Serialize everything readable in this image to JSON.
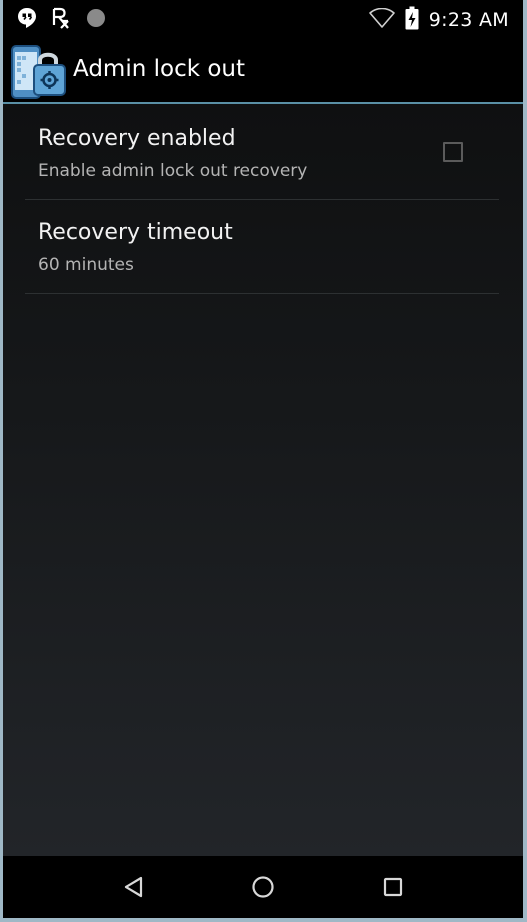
{
  "status_bar": {
    "time": "9:23 AM",
    "icons": [
      "hangouts-icon",
      "rx-icon",
      "circle-icon",
      "wifi-icon",
      "battery-charging-icon"
    ]
  },
  "action_bar": {
    "title": "Admin lock out",
    "icon": "admin-lock-app-icon",
    "accent_color": "#5a90a6"
  },
  "preferences": [
    {
      "title": "Recovery enabled",
      "summary": "Enable admin lock out recovery",
      "checkbox_checked": false
    },
    {
      "title": "Recovery timeout",
      "summary": "60 minutes"
    }
  ],
  "nav_bar": {
    "buttons": [
      "back-icon",
      "home-icon",
      "recents-icon"
    ]
  }
}
